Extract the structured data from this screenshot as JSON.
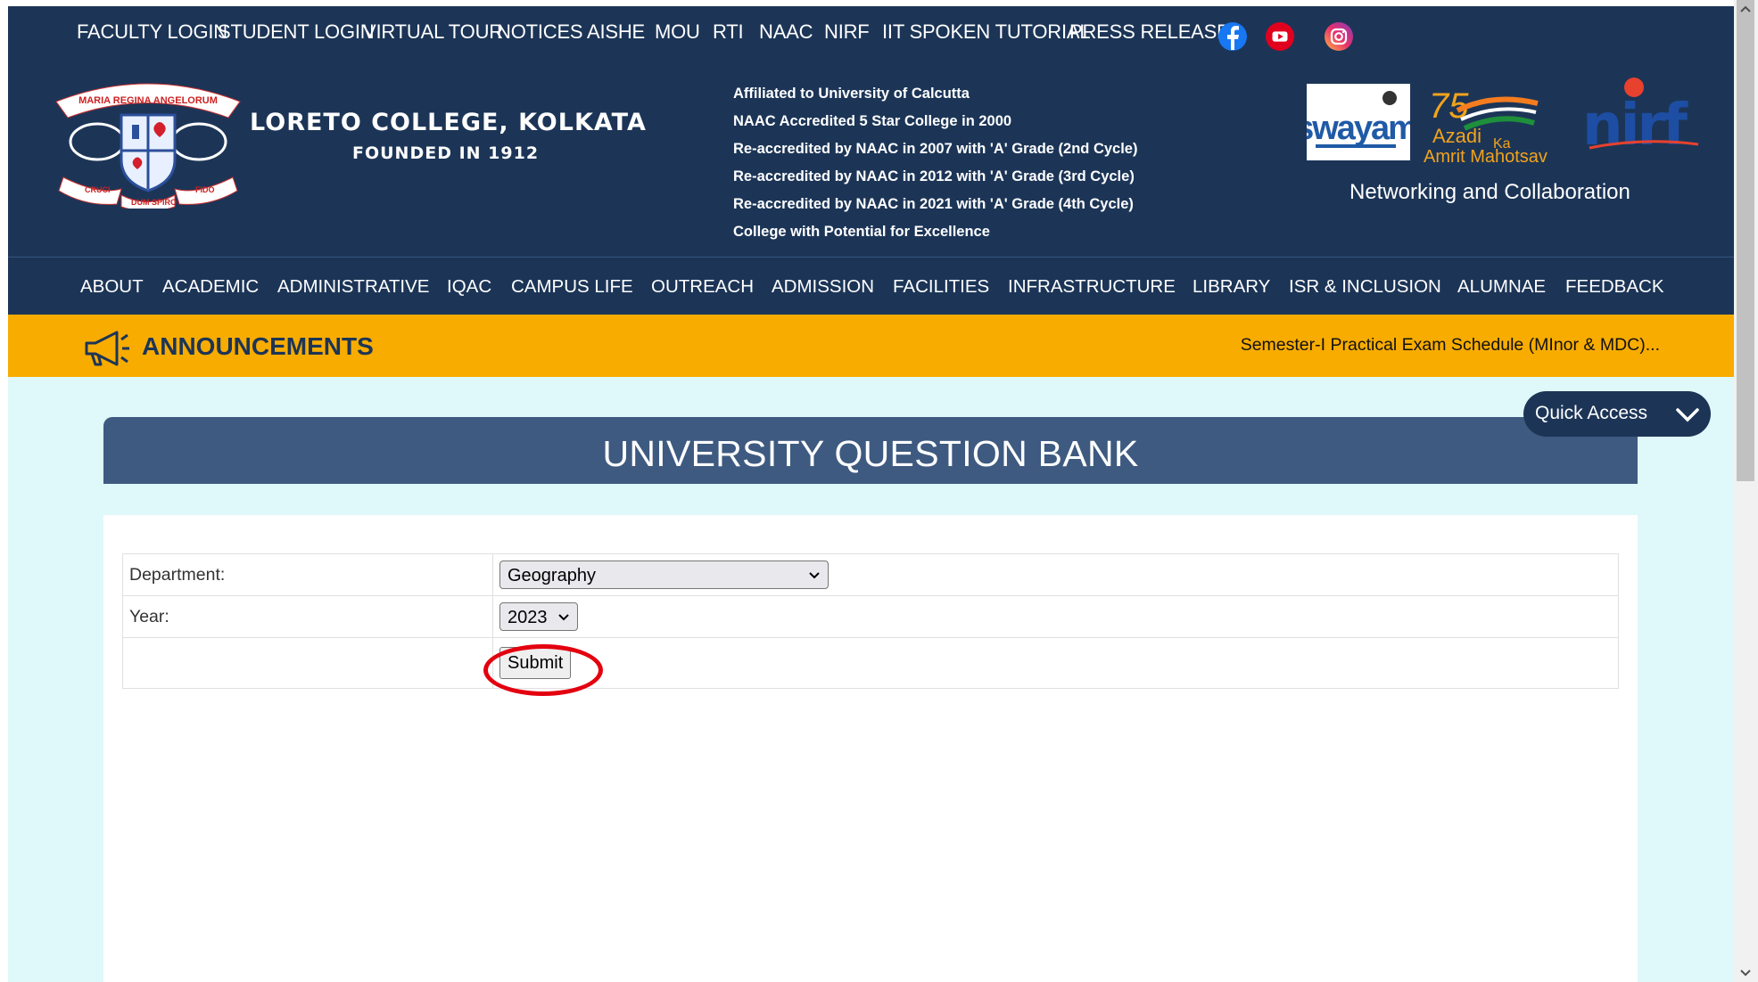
{
  "topbar": {
    "links": [
      "FACULTY LOGIN",
      "STUDENT LOGIN",
      "VIRTUAL TOUR",
      "NOTICES",
      "AISHE",
      "MOU",
      "RTI",
      "NAAC",
      "NIRF",
      "IIT SPOKEN TUTORIAL",
      "PRESS RELEASE"
    ],
    "social": [
      "facebook-icon",
      "youtube-icon",
      "instagram-icon"
    ]
  },
  "header": {
    "logo_motto": [
      "MARIA REGINA ANGELORUM",
      "CRUCI",
      "DUM SPIRO",
      "FIDO"
    ],
    "college_name": "LORETO COLLEGE, KOLKATA",
    "founded": "FOUNDED IN 1912",
    "affiliations": [
      "Affiliated to University of Calcutta",
      "NAAC Accredited 5 Star College in 2000",
      "Re-accredited by NAAC in 2007 with 'A' Grade (2nd Cycle)",
      "Re-accredited by NAAC in 2012 with 'A' Grade (3rd Cycle)",
      "Re-accredited by NAAC in 2021 with 'A' Grade (4th Cycle)",
      "College with Potential for Excellence"
    ],
    "partners": {
      "swayam": "swayam",
      "azadi_line1": "Azadi",
      "azadi_ka": "Ka",
      "azadi_line2": "Amrit Mahotsav",
      "azadi_75": "75",
      "nirf": "nirf"
    },
    "networking": "Networking and Collaboration"
  },
  "mainnav": [
    "ABOUT",
    "ACADEMIC",
    "ADMINISTRATIVE",
    "IQAC",
    "CAMPUS LIFE",
    "OUTREACH",
    "ADMISSION",
    "FACILITIES",
    "INFRASTRUCTURE",
    "LIBRARY",
    "ISR & INCLUSION",
    "ALUMNAE",
    "FEEDBACK"
  ],
  "announcements": {
    "title": "ANNOUNCEMENTS",
    "ticker": "Semester-I Practical Exam Schedule (MInor & MDC)..."
  },
  "quick_access": "Quick Access",
  "page_title": "UNIVERSITY QUESTION BANK",
  "form": {
    "department_label": "Department:",
    "department_value": "Geography",
    "year_label": "Year:",
    "year_value": "2023",
    "submit_label": "Submit"
  },
  "colors": {
    "navy": "#1c3557",
    "announcement_bar": "#f8ac00",
    "title_band": "#3e5a80",
    "page_bg": "#dff8fa",
    "highlight_circle": "#e3000f"
  }
}
